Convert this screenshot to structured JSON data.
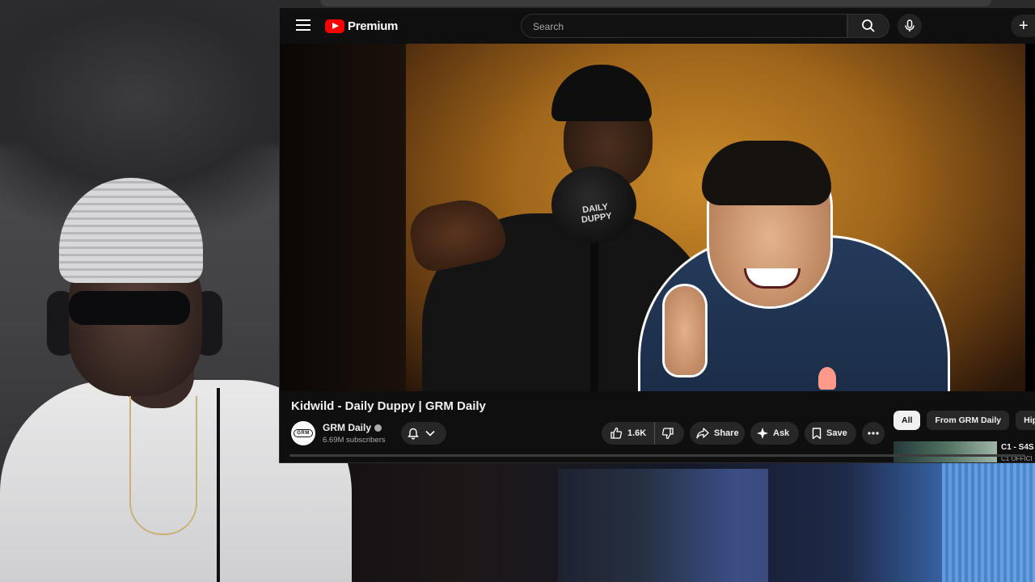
{
  "header": {
    "logo_text": "Premium",
    "search_placeholder": "Search",
    "create_symbol": "+"
  },
  "video": {
    "title": "Kidwild - Daily Duppy | GRM Daily",
    "mic_text": "DAILY DUPPY"
  },
  "channel": {
    "avatar_text": "GRM",
    "name": "GRM Daily",
    "subscribers": "6.69M subscribers"
  },
  "actions": {
    "likes": "1.6K",
    "share": "Share",
    "ask": "Ask",
    "save": "Save"
  },
  "chips": [
    "All",
    "From GRM Daily",
    "Hip ho"
  ],
  "recommended": {
    "title": "C1 - S4S",
    "subtitle": "C1 OFFICI"
  },
  "colors": {
    "brand_red": "#ff0000",
    "background": "#0f0f0f",
    "pill": "#272727"
  }
}
